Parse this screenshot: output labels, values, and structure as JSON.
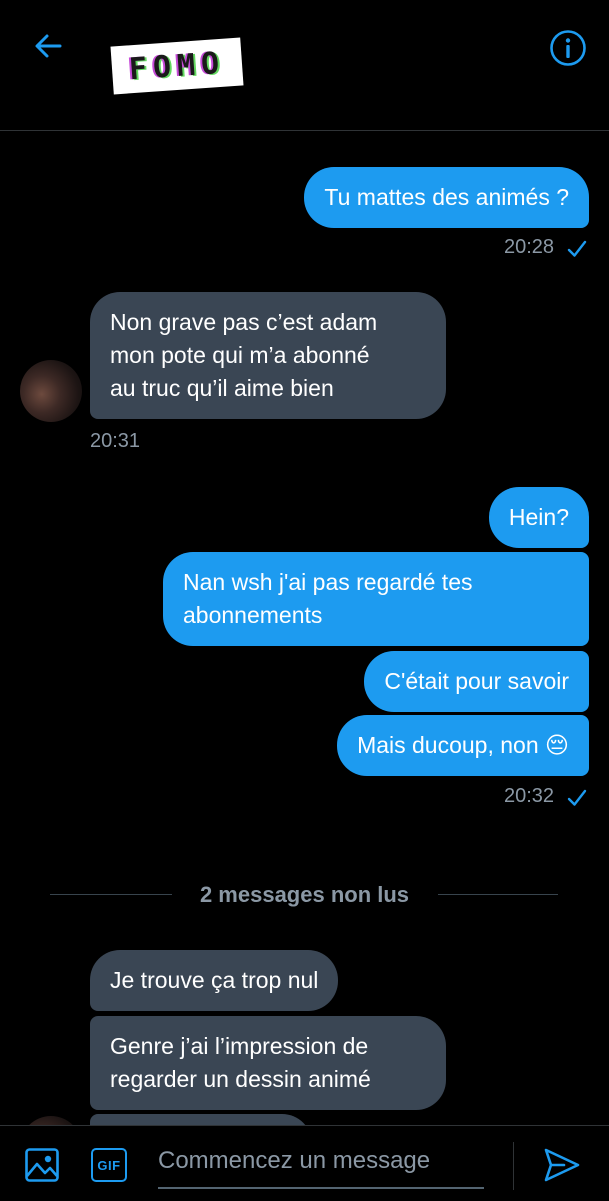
{
  "header": {
    "logo_text": "FOMO"
  },
  "messages": {
    "m1": "Tu mattes des animés ?",
    "t1": "20:28",
    "m2": "Non grave pas c’est adam\nmon pote qui m’a abonné\nau truc qu’il aime bien",
    "t2": "20:31",
    "m3": "Hein?",
    "m4": "Nan wsh j'ai pas regardé tes\nabonnements",
    "m5": "C'était pour savoir",
    "m6": "Mais ducoup, non 😔",
    "t3": "20:32",
    "divider": "2 messages non lus",
    "m7": "Je trouve ça trop nul",
    "m8": "Genre j’ai l’impression de\nregarder un dessin animé"
  },
  "composer": {
    "placeholder": "Commencez un message",
    "gif_label": "GIF"
  },
  "colors": {
    "accent": "#1d9bf0",
    "incoming": "#3a4654",
    "background": "#000000"
  },
  "icons": [
    "back-arrow-icon",
    "info-icon",
    "check-icon",
    "image-icon",
    "gif-icon",
    "send-icon"
  ]
}
